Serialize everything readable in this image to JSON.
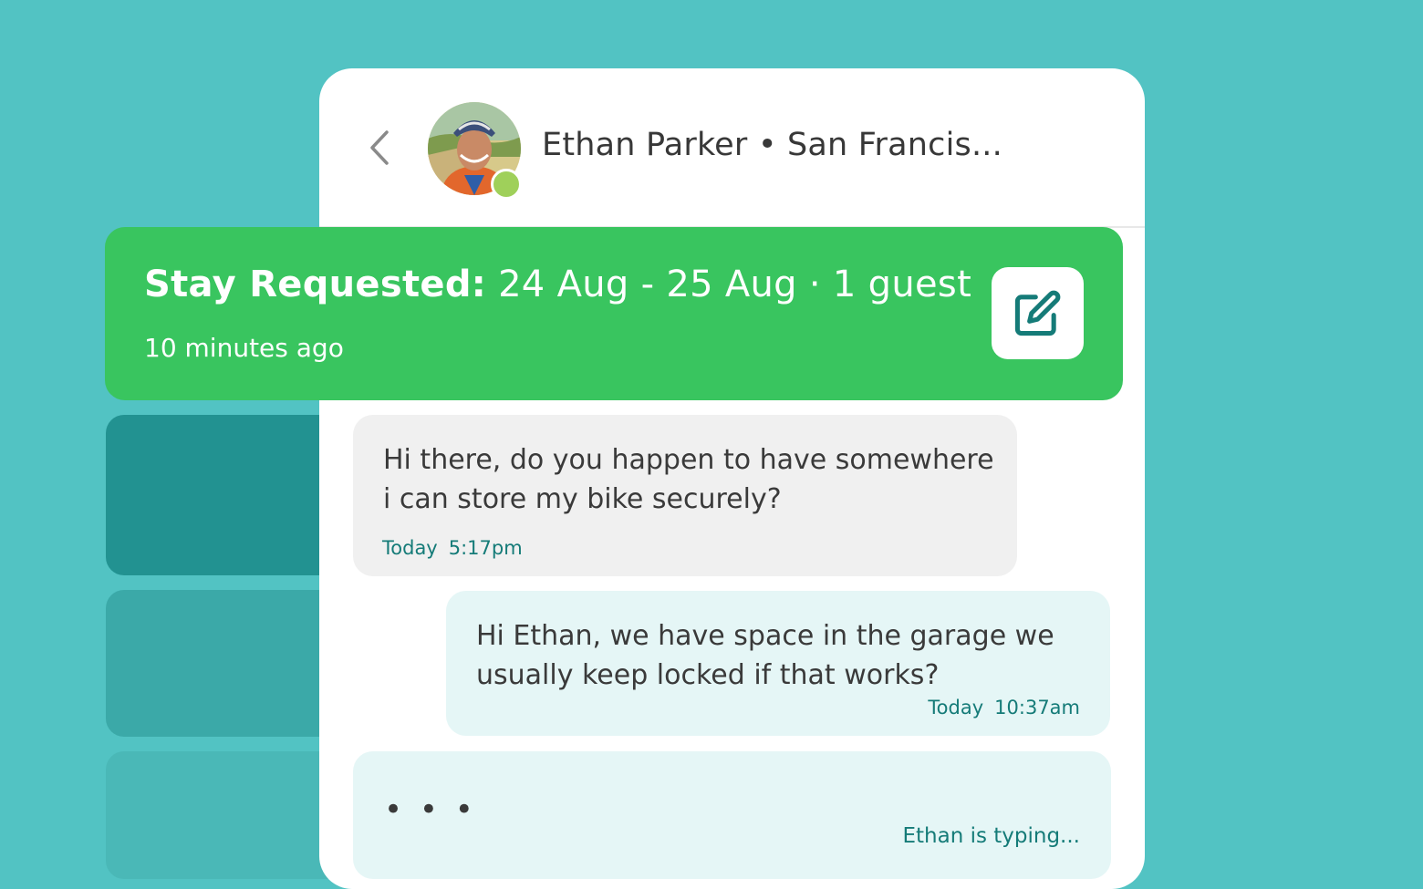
{
  "conversation": {
    "contact_name": "Ethan Parker • San Francis...",
    "online": true
  },
  "banner": {
    "title_bold": "Stay Requested:",
    "title_rest": "24 Aug - 25 Aug · 1 guest",
    "time": "10 minutes ago"
  },
  "messages": [
    {
      "direction": "incoming",
      "text": "Hi there, do you happen to have somewhere i can store my bike securely?",
      "day": "Today",
      "time": "5:17pm"
    },
    {
      "direction": "outgoing",
      "text": "Hi Ethan, we have space in the garage we usually keep locked if that works?",
      "day": "Today",
      "time": "10:37am"
    }
  ],
  "typing": {
    "dots": "• • •",
    "status": "Ethan is typing..."
  },
  "icons": {
    "back": "chevron-left-icon",
    "edit": "edit-icon",
    "online": "online-status-dot"
  },
  "colors": {
    "background": "#52c3c3",
    "banner": "#39c55f",
    "accent": "#157b78",
    "online": "#9fd05a"
  }
}
